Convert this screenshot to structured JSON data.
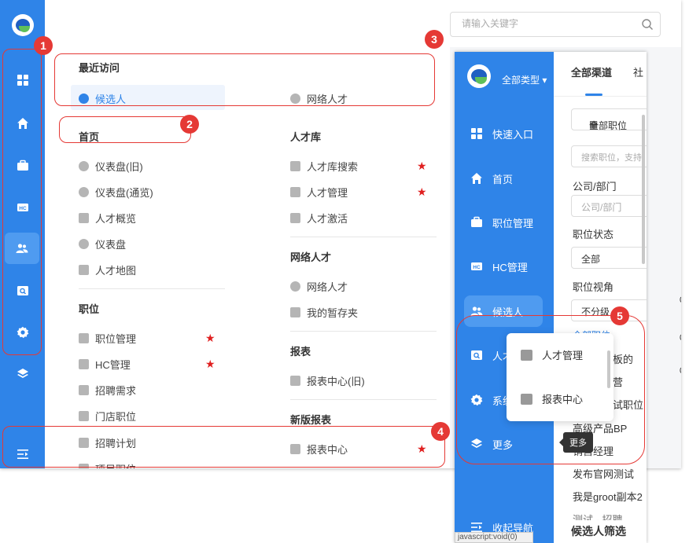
{
  "search": {
    "placeholder": "请输入关键字"
  },
  "recent": {
    "title": "最近访问",
    "items": [
      "候选人",
      "网络人才"
    ]
  },
  "home": {
    "title": "首页",
    "items": [
      "仪表盘(旧)",
      "仪表盘(通览)",
      "人才概览",
      "仪表盘",
      "人才地图"
    ]
  },
  "position": {
    "title": "职位",
    "items": [
      "职位管理",
      "HC管理",
      "招聘需求",
      "门店职位",
      "招聘计划",
      "项目职位"
    ]
  },
  "talent_pool": {
    "title": "人才库",
    "items": [
      "人才库搜索",
      "人才管理",
      "人才激活"
    ]
  },
  "network_talent": {
    "title": "网络人才",
    "items": [
      "网络人才",
      "我的暂存夹"
    ]
  },
  "reports": {
    "title": "报表",
    "items": [
      "报表中心(旧)"
    ]
  },
  "new_reports": {
    "title": "新版报表",
    "items": [
      "报表中心"
    ]
  },
  "badges": [
    "1",
    "2",
    "3",
    "4",
    "5"
  ],
  "popup": {
    "type_selector": "全部类型",
    "nav": [
      "快速入口",
      "首页",
      "职位管理",
      "HC管理",
      "候选人",
      "人才",
      "系统",
      "更多"
    ],
    "collapse": "收起导航",
    "tabs": [
      "全部渠道",
      "社"
    ],
    "all_positions": "全部职位",
    "search_placeholder": "搜索职位，支持",
    "company_label": "公司/部门",
    "company_placeholder": "公司/部门",
    "status_label": "职位状态",
    "status_value": "全部",
    "view_label": "职位视角",
    "view_value": "不分级",
    "view_link": "全部职位",
    "list": [
      "模板的",
      "运营",
      "测试职位",
      "高级产品BP",
      "销售经理",
      "发布官网测试",
      "我是groot副本2",
      "测试 - 招聘"
    ],
    "footer_title": "候选人筛选",
    "flyout": [
      "人才管理",
      "报表中心"
    ],
    "tooltip": "更多",
    "status_url": "javascript:void(0)"
  },
  "edge_digits": [
    "0",
    "0",
    "0"
  ],
  "colors": {
    "accent": "#2f84e8",
    "annotation": "#e53935",
    "star": "#e02020"
  }
}
